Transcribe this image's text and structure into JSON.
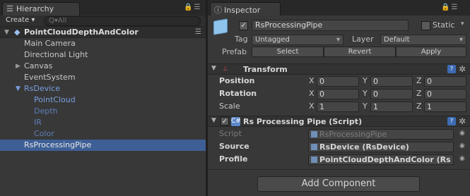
{
  "hierarchy": {
    "tab_label": "Hierarchy",
    "tab_icon": "hierarchy-list-icon",
    "create_label": "Create ▾",
    "search_placeholder": "Q▾All",
    "scene_name": "PointCloudDepthAndColor",
    "items": [
      {
        "label": "Main Camera"
      },
      {
        "label": "Directional Light"
      },
      {
        "label": "Canvas"
      },
      {
        "label": "EventSystem"
      },
      {
        "label": "RsDevice"
      },
      {
        "label": "PointCloud"
      },
      {
        "label": "Depth"
      },
      {
        "label": "IR"
      },
      {
        "label": "Color"
      },
      {
        "label": "RsProcessingPipe"
      }
    ]
  },
  "inspector": {
    "tab_label": "Inspector",
    "tab_icon": "info-icon",
    "object_name": "RsProcessingPipe",
    "static_label": "Static",
    "tag_label": "Tag",
    "tag_value": "Untagged",
    "layer_label": "Layer",
    "layer_value": "Default",
    "prefab_label": "Prefab",
    "prefab_buttons": [
      "Select",
      "Revert",
      "Apply"
    ],
    "transform": {
      "title": "Transform",
      "rows": [
        {
          "label": "Position",
          "x": "0",
          "y": "0",
          "z": "0"
        },
        {
          "label": "Rotation",
          "x": "0",
          "y": "0",
          "z": "0"
        },
        {
          "label": "Scale",
          "x": "1",
          "y": "1",
          "z": "1"
        }
      ],
      "axis_labels": [
        "X",
        "Y",
        "Z"
      ]
    },
    "script_component": {
      "title": "Rs Processing Pipe (Script)",
      "rows": [
        {
          "label": "Script",
          "value": "RsProcessingPipe"
        },
        {
          "label": "Source",
          "value": "RsDevice (RsDevice)"
        },
        {
          "label": "Profile",
          "value": "PointCloudDepthAndColor (Rs"
        }
      ]
    },
    "add_component_label": "Add Component"
  }
}
